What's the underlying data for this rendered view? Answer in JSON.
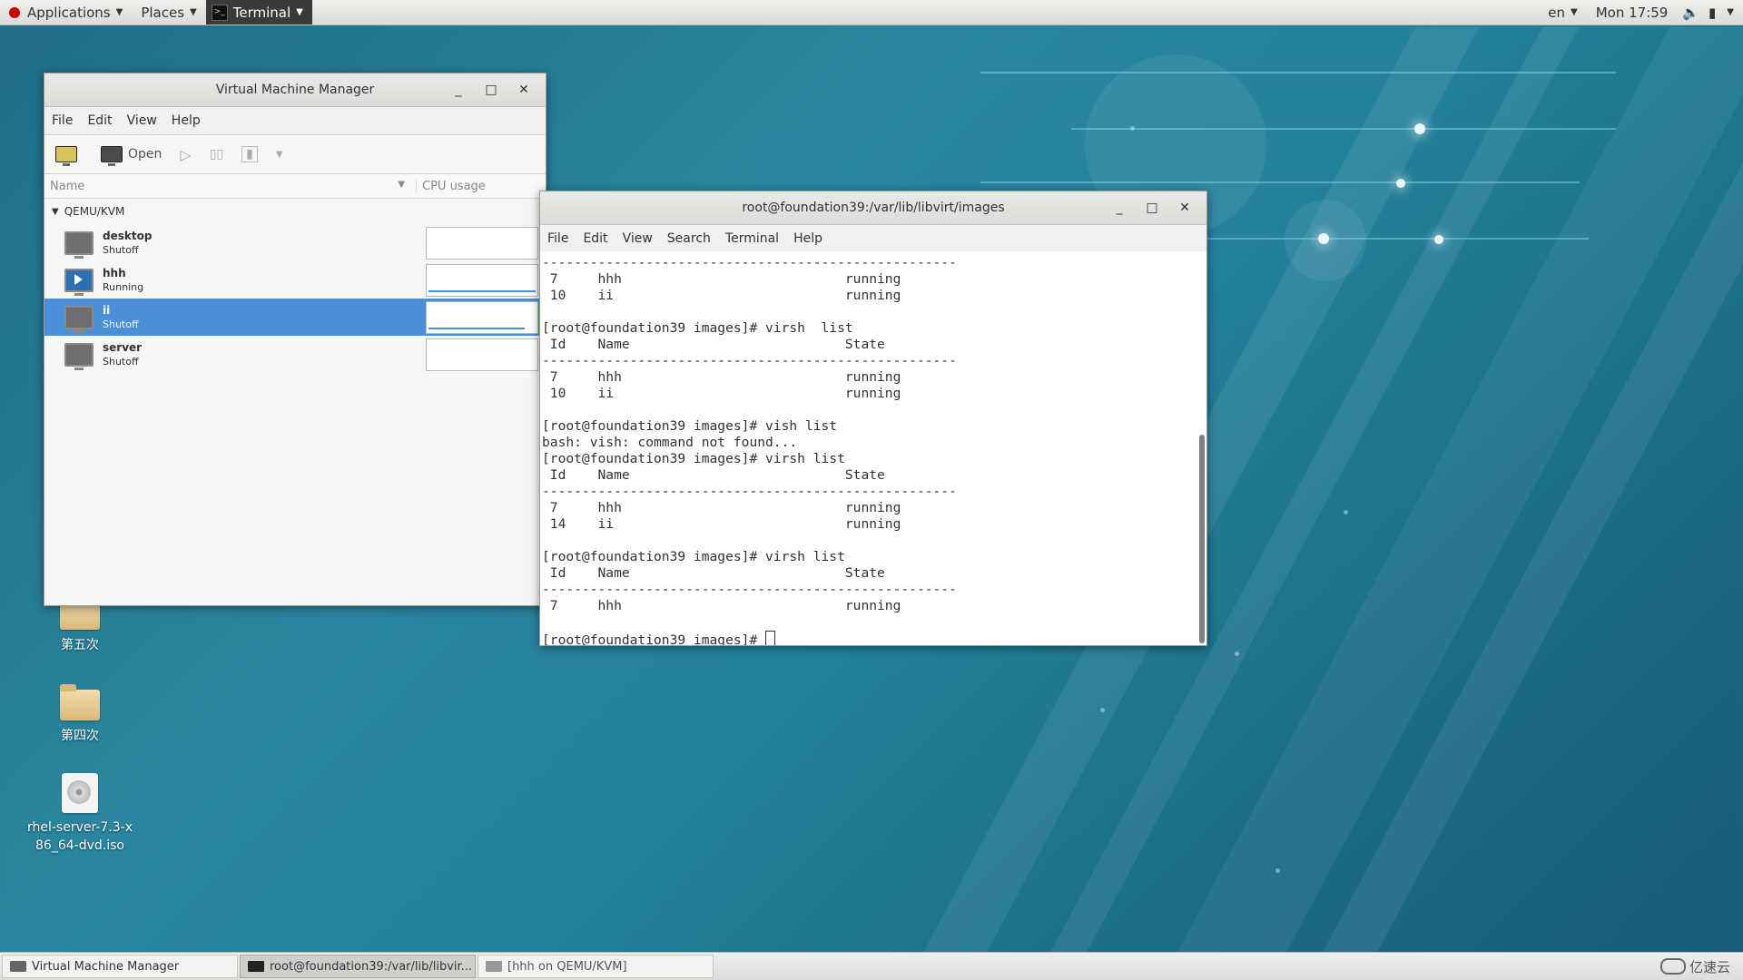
{
  "topbar": {
    "applications": "Applications",
    "places": "Places",
    "terminal": "Terminal",
    "lang": "en",
    "clock": "Mon 17:59"
  },
  "desktop": {
    "icons": [
      {
        "label": "第五次"
      },
      {
        "label": "第四次"
      },
      {
        "label": "rhel-server-7.3-x86_64-dvd.iso"
      }
    ]
  },
  "vmm": {
    "title": "Virtual Machine Manager",
    "menu": [
      "File",
      "Edit",
      "View",
      "Help"
    ],
    "toolbar": {
      "open": "Open"
    },
    "columns": {
      "name": "Name",
      "cpu": "CPU usage"
    },
    "group": "QEMU/KVM",
    "vms": [
      {
        "name": "desktop",
        "state": "Shutoff"
      },
      {
        "name": "hhh",
        "state": "Running"
      },
      {
        "name": "ii",
        "state": "Shutoff"
      },
      {
        "name": "server",
        "state": "Shutoff"
      }
    ]
  },
  "terminal": {
    "title": "root@foundation39:/var/lib/libvirt/images",
    "menu": [
      "File",
      "Edit",
      "View",
      "Search",
      "Terminal",
      "Help"
    ],
    "lines": [
      "----------------------------------------------------",
      " 7     hhh                            running",
      " 10    ii                             running",
      "",
      "[root@foundation39 images]# virsh  list",
      " Id    Name                           State",
      "----------------------------------------------------",
      " 7     hhh                            running",
      " 10    ii                             running",
      "",
      "[root@foundation39 images]# vish list",
      "bash: vish: command not found...",
      "[root@foundation39 images]# virsh list",
      " Id    Name                           State",
      "----------------------------------------------------",
      " 7     hhh                            running",
      " 14    ii                             running",
      "",
      "[root@foundation39 images]# virsh list",
      " Id    Name                           State",
      "----------------------------------------------------",
      " 7     hhh                            running",
      ""
    ],
    "prompt": "[root@foundation39 images]# "
  },
  "taskbar": {
    "tasks": [
      {
        "label": "Virtual Machine Manager"
      },
      {
        "label": "root@foundation39:/var/lib/libvir..."
      },
      {
        "label": "[hhh on QEMU/KVM]"
      }
    ],
    "watermark": "亿速云"
  }
}
